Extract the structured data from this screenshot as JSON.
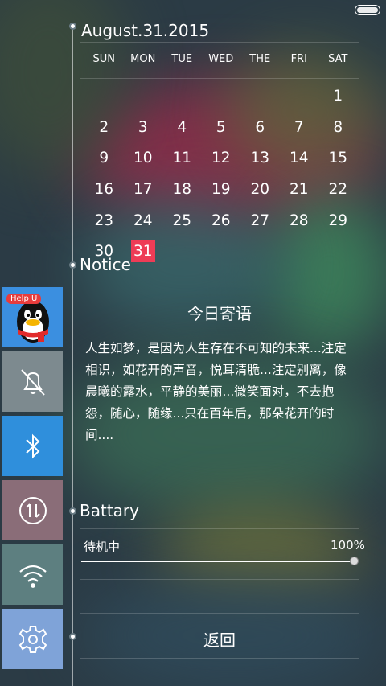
{
  "calendar": {
    "title": "August.31.2015",
    "weekdays": [
      "SUN",
      "MON",
      "TUE",
      "WED",
      "THE",
      "FRI",
      "SAT"
    ],
    "weeks": [
      [
        "",
        "",
        "",
        "",
        "",
        "",
        "1"
      ],
      [
        "2",
        "3",
        "4",
        "5",
        "6",
        "7",
        "8"
      ],
      [
        "9",
        "10",
        "11",
        "12",
        "13",
        "14",
        "15"
      ],
      [
        "16",
        "17",
        "18",
        "19",
        "20",
        "21",
        "22"
      ],
      [
        "23",
        "24",
        "25",
        "26",
        "27",
        "28",
        "29"
      ],
      [
        "30",
        "31",
        "",
        "",
        "",
        "",
        ""
      ]
    ],
    "today": "31",
    "today_color": "#ee3c56"
  },
  "notice": {
    "heading": "Notice",
    "title": "今日寄语",
    "body": "人生如梦，是因为人生存在不可知的未来...注定相识，如花开的声音，悦耳清脆...注定别离，像晨曦的露水，平静的美丽...微笑面对，不去抱怨，随心，随缘...只在百年后，那朵花开的时间...."
  },
  "battery": {
    "heading": "Battary",
    "status": "待机中",
    "percent_label": "100%",
    "level": 1.0
  },
  "back_label": "返回",
  "sidebar": {
    "items": [
      {
        "name": "help-u",
        "badge": "Help U",
        "icon": "qq-penguin-icon",
        "color": "#3b8fe0"
      },
      {
        "name": "silent",
        "icon": "bell-off-icon",
        "color": "#7d8a8f"
      },
      {
        "name": "bluetooth",
        "icon": "bluetooth-icon",
        "color": "#2f8fdc"
      },
      {
        "name": "data",
        "icon": "data-transfer-icon",
        "color": "#8a6d78"
      },
      {
        "name": "wifi",
        "icon": "wifi-icon",
        "color": "#5d7f80"
      },
      {
        "name": "settings",
        "icon": "gear-icon",
        "color": "#7fa3d8"
      }
    ]
  }
}
